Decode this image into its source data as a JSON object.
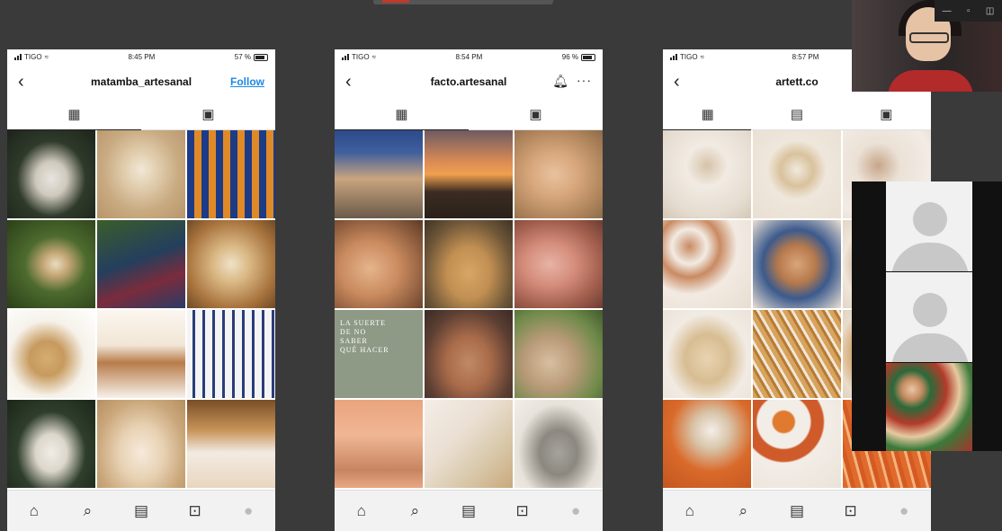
{
  "phones": [
    {
      "status": {
        "carrier": "TIGO",
        "time": "8:45 PM",
        "battery": "57 %"
      },
      "username": "matamba_artesanal",
      "action": "Follow",
      "tab_icons": [
        "grid-icon",
        "tagged-icon"
      ]
    },
    {
      "status": {
        "carrier": "TIGO",
        "time": "8:54 PM",
        "battery": "96 %"
      },
      "username": "facto.artesanal",
      "tab_icons": [
        "grid-icon",
        "tagged-icon"
      ],
      "caption_lines": [
        "LA SUERTE",
        "DE NO",
        "SABER",
        "QUÉ HACER"
      ]
    },
    {
      "status": {
        "carrier": "TIGO",
        "time": "8:57 PM",
        "battery": ""
      },
      "username": "artett.co",
      "tab_icons": [
        "grid-icon",
        "reels-icon",
        "tagged-icon"
      ]
    }
  ],
  "bottom_nav": [
    "home-icon",
    "search-icon",
    "reels-icon",
    "shop-icon",
    "profile-icon"
  ],
  "accent_color": "#1e88e5"
}
